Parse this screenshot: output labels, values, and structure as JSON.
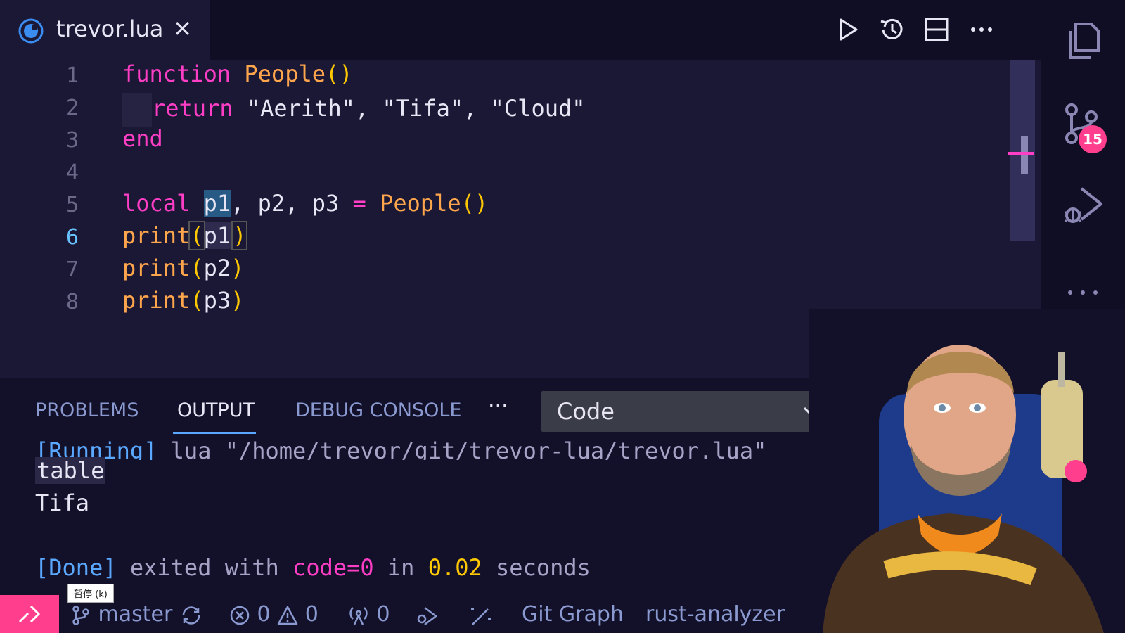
{
  "tab": {
    "title": "trevor.lua",
    "close": "✕"
  },
  "editor": {
    "lines": [
      {
        "n": "1"
      },
      {
        "n": "2"
      },
      {
        "n": "3"
      },
      {
        "n": "4"
      },
      {
        "n": "5"
      },
      {
        "n": "6"
      },
      {
        "n": "7"
      },
      {
        "n": "8"
      }
    ],
    "active_line": 6,
    "code": {
      "l1_kw": "function",
      "l1_fn": "People",
      "l1_paren": "()",
      "l2_kw": "return",
      "l2_s1": "\"Aerith\"",
      "l2_c1": ", ",
      "l2_s2": "\"Tifa\"",
      "l2_c2": ", ",
      "l2_s3": "\"Cloud\"",
      "l3_kw": "end",
      "l5_kw": "local",
      "l5_p1": "p1",
      "l5_rest": ", p2, p3 ",
      "l5_eq": "=",
      "l5_fn": "People",
      "l5_paren": "()",
      "l6_fn": "print",
      "l6_open": "(",
      "l6_arg": "p1",
      "l6_close": ")",
      "l7_fn": "print",
      "l7_open": "(",
      "l7_arg": "p2",
      "l7_close": ")",
      "l8_fn": "print",
      "l8_open": "(",
      "l8_arg": "p3",
      "l8_close": ")"
    }
  },
  "activity": {
    "badge": "15"
  },
  "panel": {
    "tabs": [
      "PROBLEMS",
      "OUTPUT",
      "DEBUG CONSOLE"
    ],
    "active_tab": "OUTPUT",
    "more": "···",
    "output_channel": "Code",
    "output": {
      "running_tag": "[Running]",
      "running_cmd": " lua \"/home/trevor/git/trevor-lua/trevor.lua\"",
      "line1": "table",
      "line2": "Tifa",
      "done_tag": "[Done]",
      "done_text1": " exited with ",
      "done_code": "code=0",
      "done_text2": " in ",
      "done_time": "0.02",
      "done_text3": " seconds"
    }
  },
  "statusbar": {
    "branch": "master",
    "errors": "0",
    "warnings": "0",
    "ports": "0",
    "git_graph": "Git Graph",
    "rust_analyzer": "rust-analyzer",
    "tooltip": "暂停 (k)"
  },
  "colors": {
    "keyword": "#ff3ec6",
    "function": "#ffa64d",
    "paren": "#ffc800",
    "badge": "#ff3e8e",
    "accent_blue": "#5aa8ff"
  }
}
